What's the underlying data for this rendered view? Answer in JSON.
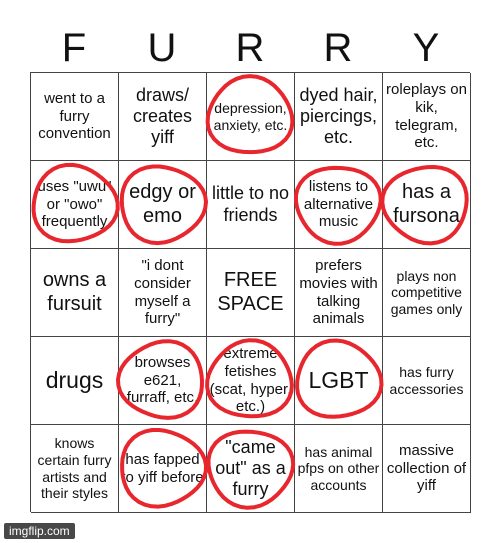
{
  "title_letters": [
    "F",
    "U",
    "R",
    "R",
    "Y"
  ],
  "cells": [
    [
      "went to a furry convention",
      "draws/ creates yiff",
      "depression, anxiety, etc.",
      "dyed hair, piercings, etc.",
      "roleplays on kik, telegram, etc."
    ],
    [
      "uses \"uwu\" or \"owo\" frequently",
      "edgy or emo",
      "little to no friends",
      "listens to alternative music",
      "has a fursona"
    ],
    [
      "owns a fursuit",
      "\"i dont consider myself a furry\"",
      "FREE SPACE",
      "prefers movies with talking animals",
      "plays non competitive games only"
    ],
    [
      "drugs",
      "browses e621, furraff, etc.",
      "extreme fetishes (scat, hyper, etc.)",
      "LGBT",
      "has furry accessories"
    ],
    [
      "knows certain furry artists and their styles",
      "has fapped to yiff before",
      "\"came out\" as a furry",
      "has animal pfps on other accounts",
      "massive collection of yiff"
    ]
  ],
  "marked_cells": [
    "r0c2",
    "r1c0",
    "r1c1",
    "r1c3",
    "r1c4",
    "r3c1",
    "r3c2",
    "r3c3",
    "r4c1",
    "r4c2"
  ],
  "mark_color": "#e8262e",
  "watermark": "imgflip.com"
}
